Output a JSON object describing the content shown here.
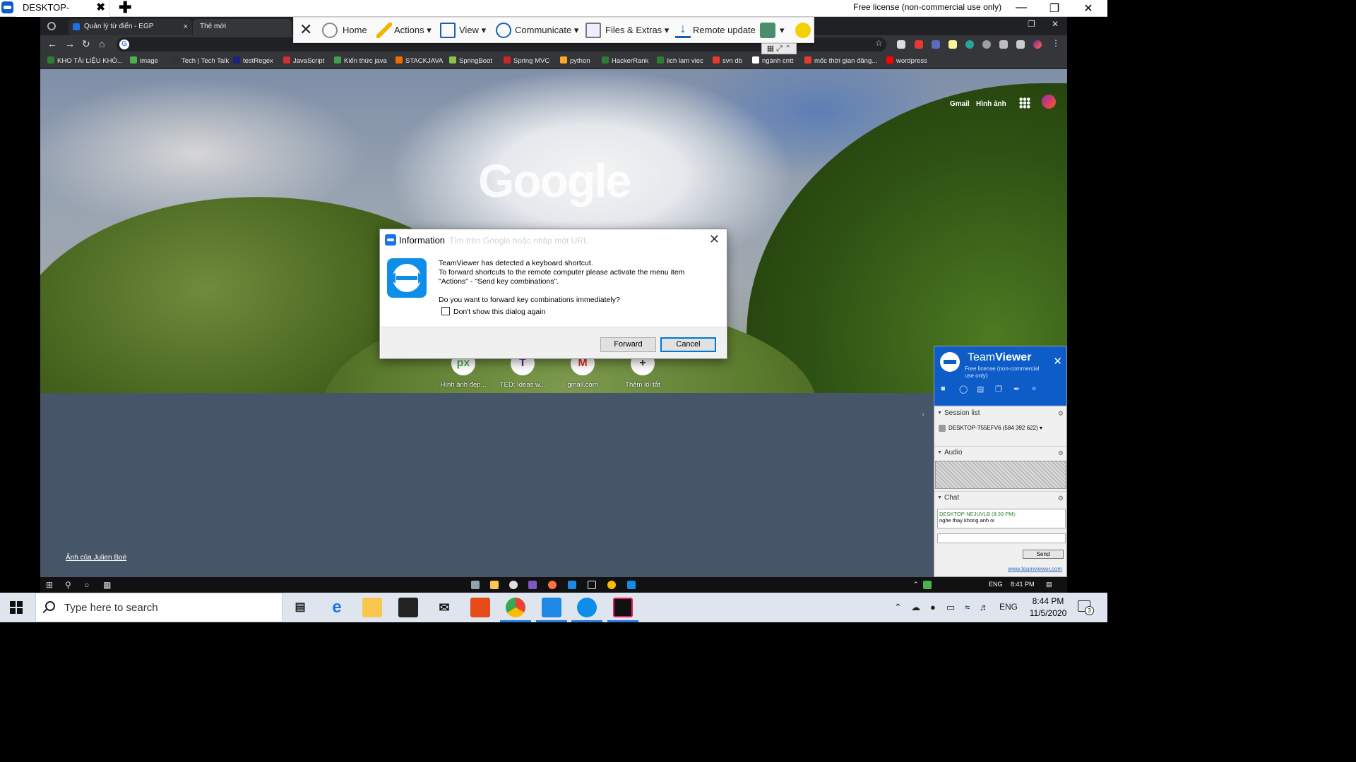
{
  "host": {
    "tab_label": "DESKTOP-NEJUVLB",
    "tab_close": "✖",
    "new_tab": "✚",
    "license": "Free license (non-commercial use only)"
  },
  "chrome": {
    "tabs": [
      {
        "label": "Quản lý từ điển - EGP",
        "close": "×"
      },
      {
        "label": "Thẻ mới"
      }
    ],
    "bookmarks": [
      {
        "label": "KHO TÀI LIỆU KHÓ...",
        "color": "#2e7d32"
      },
      {
        "label": "image",
        "color": "#4caf50"
      },
      {
        "label": "Tech | Tech Talk",
        "color": "#333"
      },
      {
        "label": "testRegex",
        "color": "#1a237e"
      },
      {
        "label": "JavaScript",
        "color": "#d32f2f"
      },
      {
        "label": "Kiến thức java",
        "color": "#43a047"
      },
      {
        "label": "STACKJAVA",
        "color": "#ef6c00"
      },
      {
        "label": "SpringBoot",
        "color": "#8bc34a"
      },
      {
        "label": "Spring MVC",
        "color": "#c62828"
      },
      {
        "label": "python",
        "color": "#f9a825"
      },
      {
        "label": "HackerRank",
        "color": "#2e7d32"
      },
      {
        "label": "lich lam viec",
        "color": "#2e7d32"
      },
      {
        "label": "svn db",
        "color": "#e53935"
      },
      {
        "label": "ngành cntt",
        "color": "#ffffff"
      },
      {
        "label": "mốc thời gian đăng...",
        "color": "#e53935"
      },
      {
        "label": "wordpress",
        "color": "#ff0000"
      }
    ]
  },
  "ntp": {
    "gmail": "Gmail",
    "images": "Hình ảnh",
    "logo": "Google",
    "search_placeholder": "Tìm trên Google hoặc nhập một URL",
    "shortcuts": [
      {
        "label": "Hình ảnh đẹp...",
        "glyph": "px",
        "color": "#4caf50"
      },
      {
        "label": "TED: Ideas w...",
        "glyph": "T",
        "color": "#6a1b9a"
      },
      {
        "label": "gmail.com",
        "glyph": "M",
        "color": "#d93025"
      },
      {
        "label": "Thêm lối tắt",
        "glyph": "+",
        "color": "#333"
      }
    ],
    "photo_credit": "Ảnh của Julien Boé"
  },
  "tv_toolbar": {
    "close": "✕",
    "items": [
      "Home",
      "Actions",
      "View",
      "Communicate",
      "Files & Extras",
      "Remote update"
    ]
  },
  "dialog": {
    "title": "Information",
    "close": "✕",
    "line1": "TeamViewer has detected a keyboard shortcut.",
    "line2": "To forward shortcuts to the remote computer please activate the menu item",
    "line3": "\"Actions\" - \"Send key combinations\".",
    "question": "Do you want to forward key combinations immediately?",
    "checkbox": "Don't show this dialog again",
    "forward": "Forward",
    "cancel": "Cancel"
  },
  "tv_panel": {
    "title_light": "Team",
    "title_bold": "Viewer",
    "subtitle": "Free license (non-commercial use only)",
    "close": "✕",
    "session_list": "Session list",
    "session": "DESKTOP-T55EFV6 (584 392 622)",
    "audio": "Audio",
    "chat": "Chat",
    "chat_sender": "DESKTOP-NEJUVLB (8:39 PM):",
    "chat_message": "nghe thay khong anh oi",
    "send": "Send",
    "link": "www.teamviewer.com"
  },
  "remote_taskbar": {
    "lang": "ENG",
    "time": "8:41 PM"
  },
  "taskbar": {
    "search_placeholder": "Type here to search",
    "lang": "ENG",
    "time": "8:44 PM",
    "date": "11/5/2020",
    "notifications": "3"
  }
}
